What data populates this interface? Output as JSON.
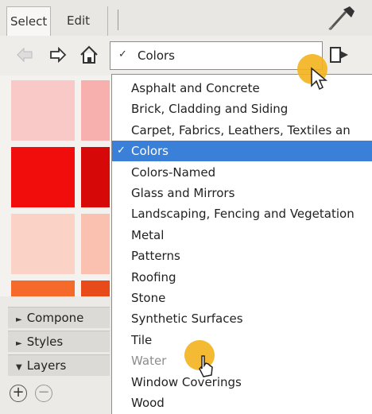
{
  "tabs": [
    {
      "label": "Select"
    },
    {
      "label": "Edit"
    }
  ],
  "toolbar": {
    "back_icon": "back-arrow-icon",
    "forward_icon": "forward-arrow-icon",
    "home_icon": "home-icon",
    "dropdown_check": "✓",
    "dropdown_value": "Colors",
    "details_icon": "details-arrow-icon"
  },
  "swatches": [
    {
      "color": "#f9c9c8"
    },
    {
      "color": "#f7b0ad"
    },
    {
      "color": "#f20d0d"
    },
    {
      "color": "#d70808"
    },
    {
      "color": "#fbd2c6"
    },
    {
      "color": "#fac0b0"
    },
    {
      "color": "#f56a2a"
    },
    {
      "color": "#e84a1a"
    }
  ],
  "sections": [
    {
      "label": "Compone",
      "arrow": "►"
    },
    {
      "label": "Styles",
      "arrow": "►"
    },
    {
      "label": "Layers",
      "arrow": "▼"
    }
  ],
  "bottom": {
    "add": "+",
    "remove": "−"
  },
  "menu": {
    "items": [
      {
        "label": "Asphalt and Concrete",
        "checked": false,
        "selected": false
      },
      {
        "label": "Brick, Cladding and Siding",
        "checked": false,
        "selected": false
      },
      {
        "label": "Carpet, Fabrics, Leathers, Textiles an",
        "checked": false,
        "selected": false
      },
      {
        "label": "Colors",
        "checked": true,
        "selected": true
      },
      {
        "label": "Colors-Named",
        "checked": false,
        "selected": false
      },
      {
        "label": "Glass and Mirrors",
        "checked": false,
        "selected": false
      },
      {
        "label": "Landscaping, Fencing and Vegetation",
        "checked": false,
        "selected": false
      },
      {
        "label": "Metal",
        "checked": false,
        "selected": false
      },
      {
        "label": "Patterns",
        "checked": false,
        "selected": false
      },
      {
        "label": "Roofing",
        "checked": false,
        "selected": false
      },
      {
        "label": "Stone",
        "checked": false,
        "selected": false
      },
      {
        "label": "Synthetic Surfaces",
        "checked": false,
        "selected": false
      },
      {
        "label": "Tile",
        "checked": false,
        "selected": false
      },
      {
        "label": "Water",
        "checked": false,
        "selected": false,
        "dim": true
      },
      {
        "label": "Window Coverings",
        "checked": false,
        "selected": false
      },
      {
        "label": "Wood",
        "checked": false,
        "selected": false
      }
    ],
    "check_glyph": "✓"
  },
  "colors": {
    "highlight": "#3a7fd8",
    "cursor_ring": "#f3b21d"
  }
}
